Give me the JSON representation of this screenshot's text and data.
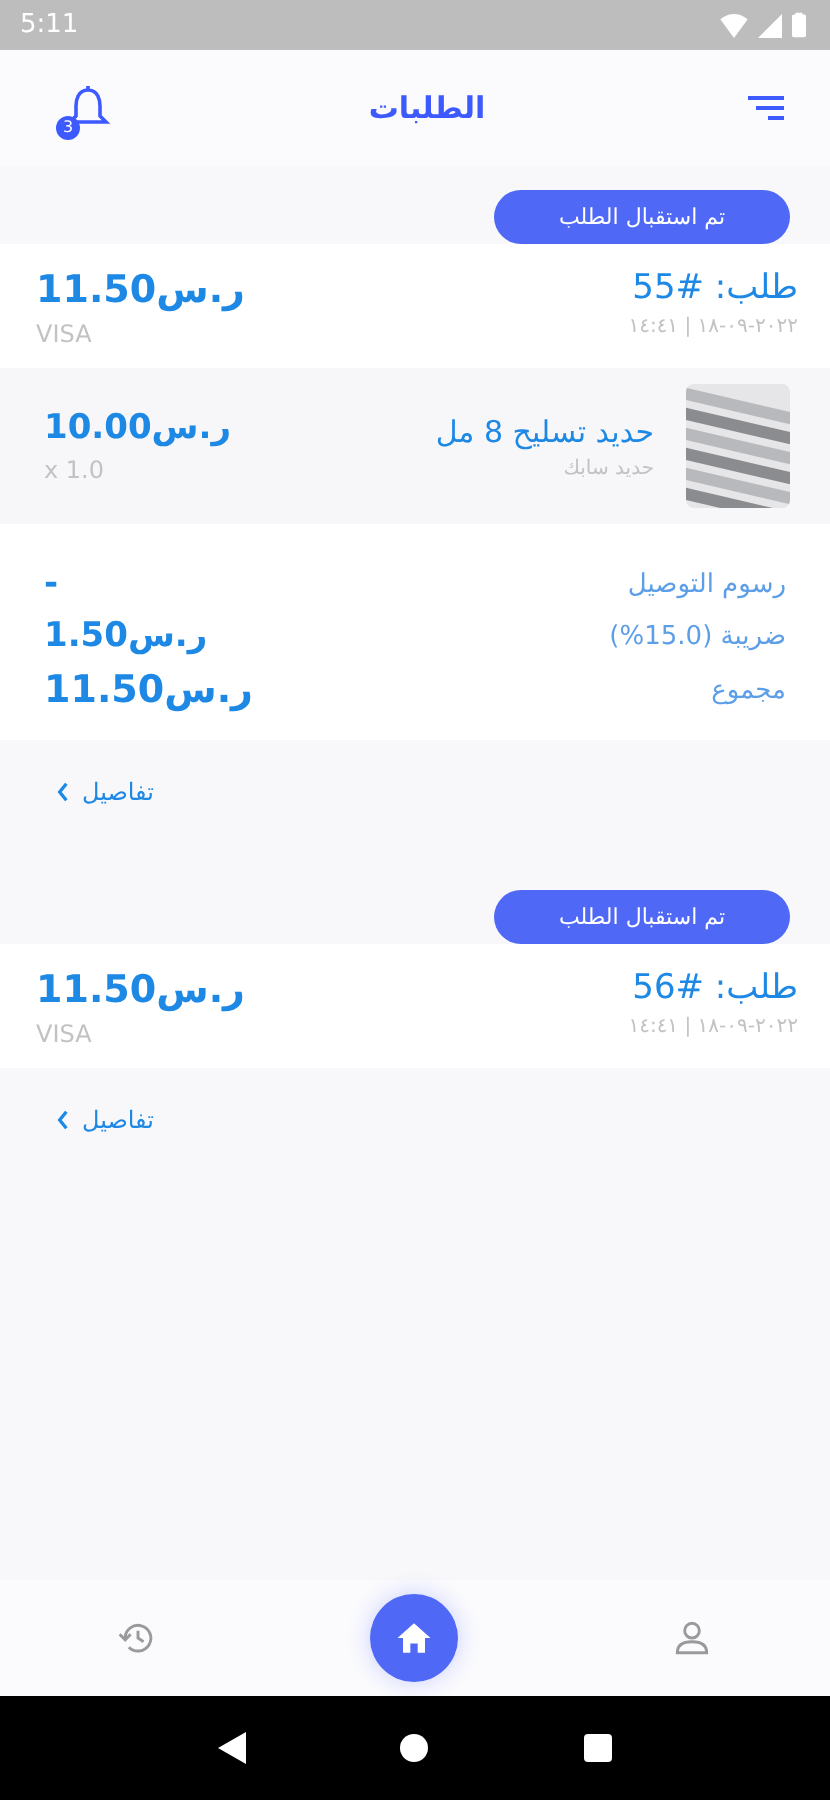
{
  "status_bar": {
    "time": "5:11"
  },
  "header": {
    "title": "الطلبات",
    "notification_count": "3"
  },
  "orders": [
    {
      "status": "تم استقبال الطلب",
      "number": "طلب: #55",
      "datetime": "٢٠٢٢-٠٩-١٨ | ١٤:٤١",
      "total": "ر.س11.50",
      "payment": "VISA",
      "items": [
        {
          "name": "حديد تسليح 8 مل",
          "brand": "حديد سابك",
          "price": "ر.س10.00",
          "quantity": "x 1.0"
        }
      ],
      "summary": [
        {
          "label": "رسوم التوصيل",
          "value": "-"
        },
        {
          "label": "ضريبة (15.0%)",
          "value": "ر.س1.50"
        },
        {
          "label": "مجموع",
          "value": "ر.س11.50",
          "kind": "total"
        }
      ],
      "details_link": "تفاصيل"
    },
    {
      "status": "تم استقبال الطلب",
      "number": "طلب: #56",
      "datetime": "٢٠٢٢-٠٩-١٨ | ١٤:٤١",
      "total": "ر.س11.50",
      "payment": "VISA",
      "details_link": "تفاصيل"
    }
  ],
  "bottom_nav": [
    {
      "kind": "history",
      "selected": false
    },
    {
      "kind": "home",
      "selected": true
    },
    {
      "kind": "profile",
      "selected": false
    }
  ]
}
